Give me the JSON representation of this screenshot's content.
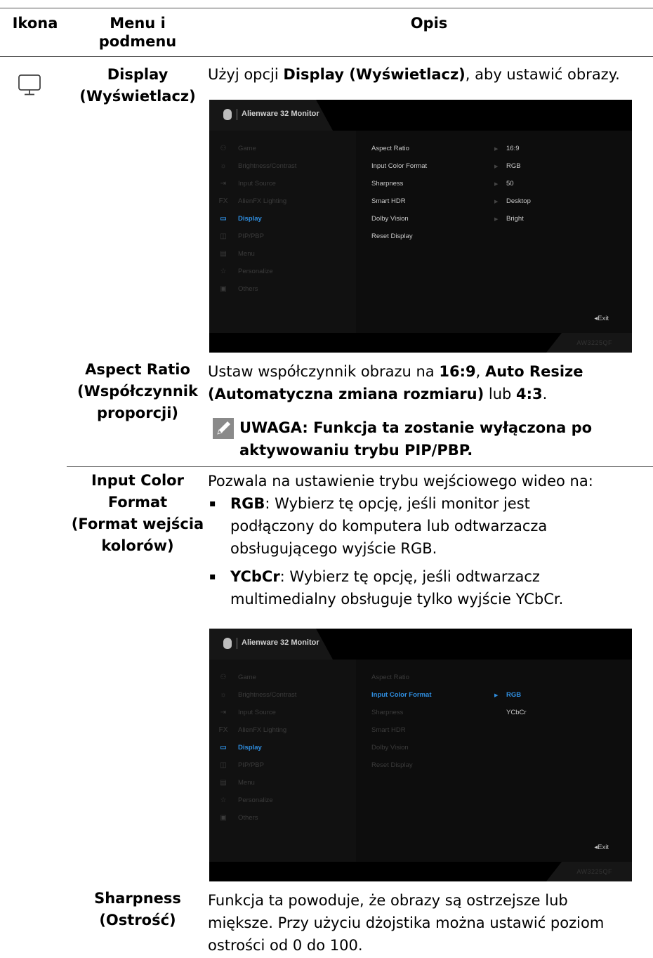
{
  "header": {
    "icon_col": "Ikona",
    "menu_col_line1": "Menu i",
    "menu_col_line2": "podmenu",
    "desc_col": "Opis"
  },
  "display_row": {
    "icon": "monitor-icon",
    "menu_line1": "Display",
    "menu_line2": "(Wyświetlacz)",
    "desc_pre": "Użyj opcji ",
    "desc_bold": "Display (Wyświetlacz)",
    "desc_post": ", aby ustawić obrazy."
  },
  "osd1": {
    "title": "Alienware 32 Monitor",
    "menu": [
      {
        "icon": "gamepad-icon",
        "glyph": "⚇",
        "label": "Game"
      },
      {
        "icon": "brightness-icon",
        "glyph": "☼",
        "label": "Brightness/Contrast"
      },
      {
        "icon": "input-source-icon",
        "glyph": "⇥",
        "label": "Input Source"
      },
      {
        "icon": "fx-icon",
        "glyph": "FX",
        "label": "AlienFX Lighting"
      },
      {
        "icon": "display-icon",
        "glyph": "▭",
        "label": "Display",
        "active": true
      },
      {
        "icon": "pip-icon",
        "glyph": "◫",
        "label": "PIP/PBP"
      },
      {
        "icon": "menu-icon",
        "glyph": "▤",
        "label": "Menu"
      },
      {
        "icon": "star-icon",
        "glyph": "☆",
        "label": "Personalize"
      },
      {
        "icon": "others-icon",
        "glyph": "▣",
        "label": "Others"
      }
    ],
    "submenu": [
      {
        "label": "Aspect Ratio",
        "value": "16:9"
      },
      {
        "label": "Input Color Format",
        "value": "RGB"
      },
      {
        "label": "Sharpness",
        "value": "50"
      },
      {
        "label": "Smart HDR",
        "value": "Desktop"
      },
      {
        "label": "Dolby Vision",
        "value": "Bright"
      },
      {
        "label": "Reset Display",
        "value": ""
      }
    ],
    "exit": "◂Exit",
    "model": "AW3225QF"
  },
  "aspect_row": {
    "menu_line1": "Aspect Ratio",
    "menu_line2": "(Współczynnik",
    "menu_line3": "proporcji)",
    "desc_l1_pre": "Ustaw współczynnik obrazu na ",
    "desc_l1_b1": "16:9",
    "desc_l1_mid": ", ",
    "desc_l1_b2": "Auto Resize",
    "desc_l2_b": "(Automatyczna zmiana rozmiaru)",
    "desc_l2_mid": " lub ",
    "desc_l2_b2": "4:3",
    "desc_l2_post": ".",
    "note_icon": "note-pencil-icon",
    "note_line1": "UWAGA: Funkcja ta zostanie wyłączona po",
    "note_line2": "aktywowaniu trybu PIP/PBP."
  },
  "color_row": {
    "menu_line1": "Input Color",
    "menu_line2": "Format",
    "menu_line3": "(Format wejścia",
    "menu_line4": "kolorów)",
    "intro": "Pozwala na ustawienie trybu wejściowego wideo na:",
    "bullet": "▪",
    "b1_bold": "RGB",
    "b1_l1": ": Wybierz tę opcję, jeśli monitor jest",
    "b1_l2": "podłączony do komputera lub odtwarzacza",
    "b1_l3": "obsługującego wyjście RGB.",
    "b2_bold": "YCbCr",
    "b2_l1": ": Wybierz tę opcję, jeśli odtwarzacz",
    "b2_l2": "multimedialny obsługuje tylko wyjście YCbCr."
  },
  "osd2": {
    "title": "Alienware 32 Monitor",
    "menu": [
      {
        "icon": "gamepad-icon",
        "glyph": "⚇",
        "label": "Game"
      },
      {
        "icon": "brightness-icon",
        "glyph": "☼",
        "label": "Brightness/Contrast"
      },
      {
        "icon": "input-source-icon",
        "glyph": "⇥",
        "label": "Input Source"
      },
      {
        "icon": "fx-icon",
        "glyph": "FX",
        "label": "AlienFX Lighting"
      },
      {
        "icon": "display-icon",
        "glyph": "▭",
        "label": "Display",
        "active": true
      },
      {
        "icon": "pip-icon",
        "glyph": "◫",
        "label": "PIP/PBP"
      },
      {
        "icon": "menu-icon",
        "glyph": "▤",
        "label": "Menu"
      },
      {
        "icon": "star-icon",
        "glyph": "☆",
        "label": "Personalize"
      },
      {
        "icon": "others-icon",
        "glyph": "▣",
        "label": "Others"
      }
    ],
    "submenu": [
      {
        "label": "Aspect Ratio"
      },
      {
        "label": "Input Color Format",
        "selected": true
      },
      {
        "label": "Sharpness"
      },
      {
        "label": "Smart HDR"
      },
      {
        "label": "Dolby Vision"
      },
      {
        "label": "Reset Display"
      }
    ],
    "options": [
      {
        "label": "RGB",
        "selected": true
      },
      {
        "label": "YCbCr"
      }
    ],
    "exit": "◂Exit",
    "model": "AW3225QF"
  },
  "sharp_row": {
    "menu_line1": "Sharpness",
    "menu_line2": "(Ostrość)",
    "desc_l1": "Funkcja ta powoduje, że obrazy są ostrzejsze lub",
    "desc_l2": "miększe. Przy użyciu dżojstika można ustawić poziom",
    "desc_l3": "ostrości od 0 do 100."
  },
  "colors": {
    "osd_active": "#2f8ee0",
    "osd_bg": "#0d0d0d"
  }
}
